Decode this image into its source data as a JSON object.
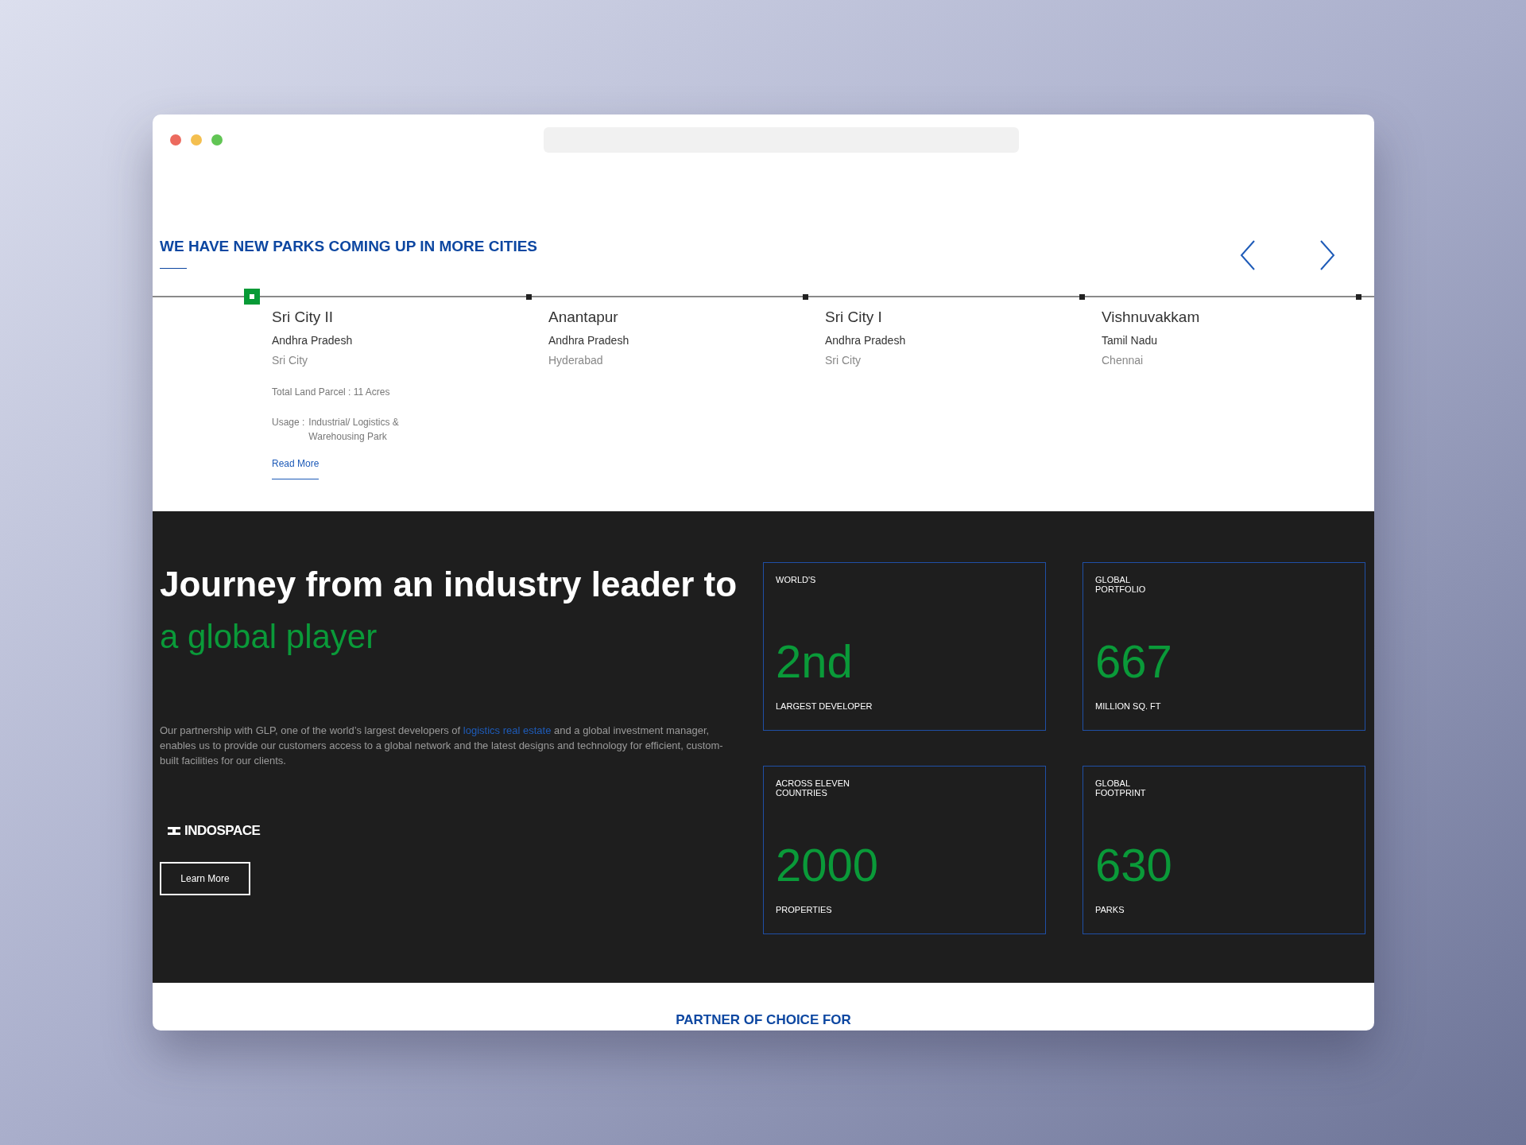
{
  "parks": {
    "title": "WE HAVE NEW PARKS COMING UP IN MORE CITIES",
    "items": [
      {
        "name": "Sri City II",
        "state": "Andhra Pradesh",
        "city": "Sri City",
        "selected": true,
        "land_parcel": "Total Land Parcel : 11 Acres",
        "usage_label": "Usage :",
        "usage": "Industrial/ Logistics & Warehousing Park",
        "link": "Read More"
      },
      {
        "name": "Anantapur",
        "state": "Andhra Pradesh",
        "city": "Hyderabad",
        "selected": false
      },
      {
        "name": "Sri City I",
        "state": "Andhra Pradesh",
        "city": "Sri City",
        "selected": false
      },
      {
        "name": "Vishnuvakkam",
        "state": "Tamil Nadu",
        "city": "Chennai",
        "selected": false
      }
    ]
  },
  "journey": {
    "heading": "Journey from an industry leader to",
    "highlight": "a global player",
    "text_before": "Our partnership with GLP, one of the world’s largest developers of",
    "link": "logistics real estate",
    "text_after": "and a global investment manager, enables us to provide our customers access to a global network and the latest designs and technology for efficient, custom-built facilities for our clients.",
    "logo": "INDOSPACE",
    "button": "Learn More"
  },
  "stats": [
    {
      "top": "WORLD'S",
      "value": "2nd",
      "bottom": "LARGEST DEVELOPER"
    },
    {
      "top": "GLOBAL PORTFOLIO",
      "value": "667",
      "bottom": "MILLION SQ. FT"
    },
    {
      "top": "ACROSS ELEVEN COUNTRIES",
      "value": "2000",
      "bottom": "PROPERTIES"
    },
    {
      "top": "GLOBAL FOOTPRINT",
      "value": "630",
      "bottom": "PARKS"
    }
  ],
  "partner": {
    "title": "PARTNER OF CHOICE FOR"
  }
}
